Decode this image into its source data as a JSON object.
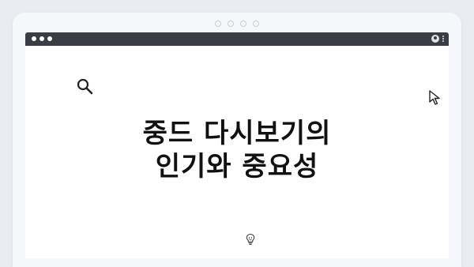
{
  "hero": {
    "title_line1": "중드 다시보기의",
    "title_line2": "인기와 중요성"
  },
  "icons": {
    "search": "search-icon",
    "cursor": "cursor-icon",
    "bulb": "lightbulb-icon",
    "profile": "profile-icon",
    "menu": "more-vert-icon"
  },
  "colors": {
    "background": "#e9ecf0",
    "browser_bar": "#3a3e44",
    "content": "#ffffff",
    "text": "#111111"
  }
}
